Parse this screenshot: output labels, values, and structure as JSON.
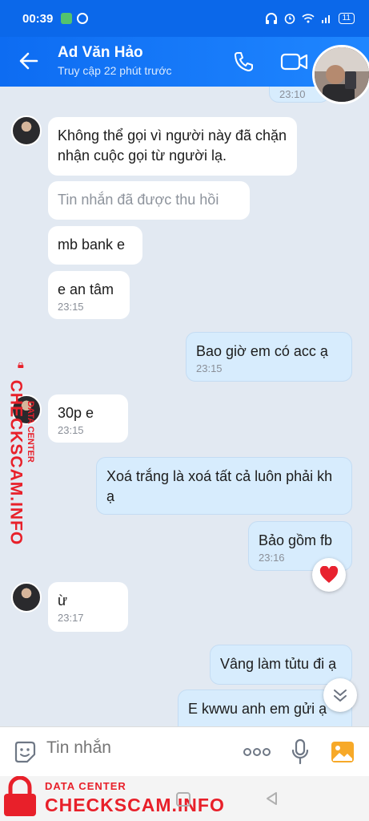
{
  "status_bar": {
    "time": "00:39",
    "battery": "11"
  },
  "header": {
    "title": "Ad Văn Hảo",
    "subtitle": "Truy cập 22 phút trước"
  },
  "messages": [
    {
      "dir": "out",
      "time": "23:10"
    },
    {
      "dir": "in",
      "text": "Không thể gọi vì người này đã chặn nhận cuộc gọi từ người lạ."
    },
    {
      "dir": "in",
      "text": "Tin nhắn đã được thu hồi"
    },
    {
      "dir": "in",
      "text": "mb bank e"
    },
    {
      "dir": "in",
      "text": "e an tâm",
      "time": "23:15"
    },
    {
      "dir": "out",
      "text": "Bao giờ em có acc ạ",
      "time": "23:15"
    },
    {
      "dir": "in",
      "text": "30p e",
      "time": "23:15"
    },
    {
      "dir": "out",
      "text": "Xoá trắng là xoá tất cả luôn phải kh ạ"
    },
    {
      "dir": "out",
      "text": "Bảo gồm fb",
      "time": "23:16",
      "reaction": "heart"
    },
    {
      "dir": "in",
      "text": "ừ",
      "time": "23:17"
    },
    {
      "dir": "out",
      "text": "Vâng làm tủtu đi ạ"
    },
    {
      "dir": "out",
      "text": "E kwwu anh em gửi ạ"
    }
  ],
  "input": {
    "placeholder": "Tin nhắn"
  },
  "watermark": {
    "small": "DATA CENTER",
    "big": "CHECKSCAM.INFO"
  },
  "colors": {
    "header": "#0b68ea",
    "bubble_out": "#d7ecfd",
    "accent": "#e8202a"
  }
}
